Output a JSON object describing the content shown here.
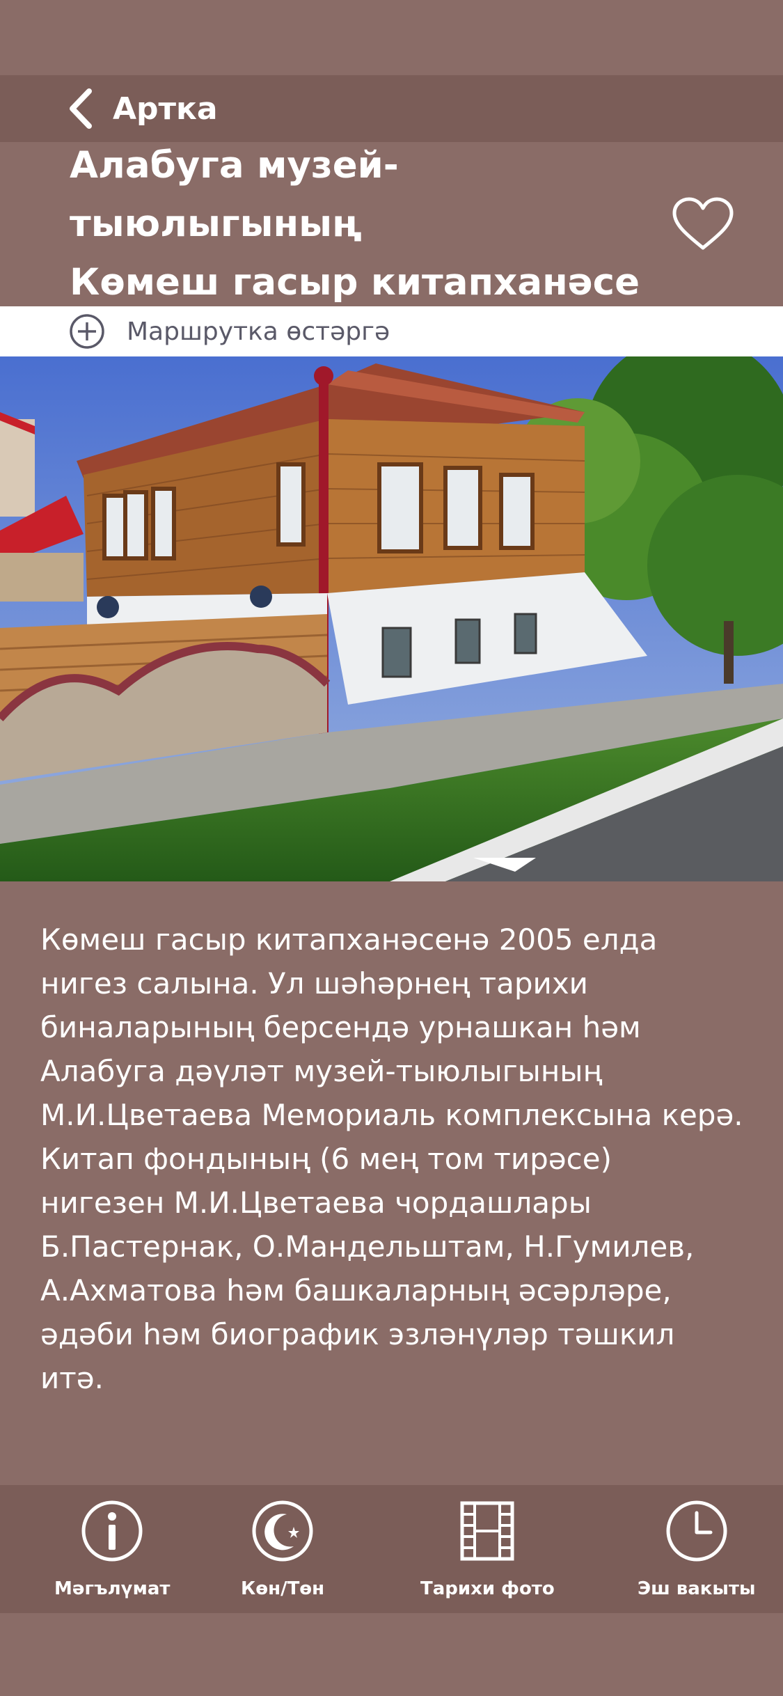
{
  "header": {
    "back_label": "Артка",
    "title_line1": "Алабуга музей-тыюлыгының",
    "title_line2": "Көмеш гасыр китапханәсе"
  },
  "route": {
    "label": "Маршрутка өстәргә"
  },
  "description": "Көмеш гасыр китапханәсенә 2005 елда нигез салына. Ул шәһәрнең тарихи биналарының берсендә урнашкан һәм Алабуга дәүләт музей-тыюлыгының М.И.Цветаева Мемориаль комплексына керә. Китап фондының (6 мең том тирәсе) нигезен М.И.Цветаева чордашлары Б.Пастернак, О.Мандельштам, Н.Гумилев, А.Ахматова һәм башкаларның әсәрләре, әдәби һәм биографик эзләнүләр тәшкил итә.",
  "tabs": [
    {
      "label": "Мәгълүмат",
      "icon": "info-icon"
    },
    {
      "label": "Көн/Төн",
      "icon": "moon-star-icon"
    },
    {
      "label": "Тарихи фото",
      "icon": "film-icon"
    },
    {
      "label": "Эш вакыты",
      "icon": "clock-icon"
    }
  ],
  "colors": {
    "background": "#8a6c67",
    "bar": "#7b5d58",
    "text": "#ffffff",
    "route_bar": "#ffffff",
    "route_text": "#5a5968"
  }
}
